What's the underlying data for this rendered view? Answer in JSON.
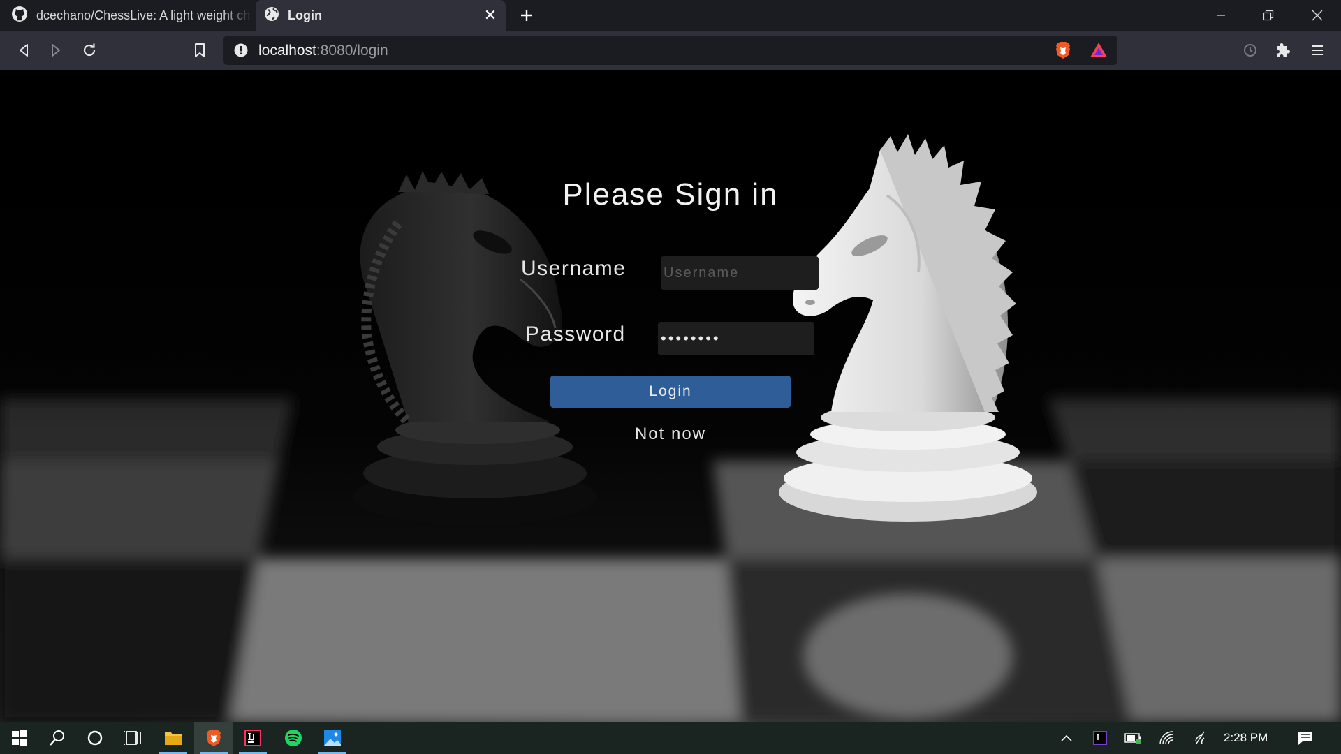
{
  "browser": {
    "tabs": [
      {
        "title": "dcechano/ChessLive: A light weight ch",
        "icon": "github-icon",
        "active": false
      },
      {
        "title": "Login",
        "icon": "globe-icon",
        "active": true
      }
    ],
    "address_bar": {
      "host": "localhost",
      "path": ":8080/login"
    }
  },
  "page": {
    "heading": "Please Sign in",
    "username": {
      "label": "Username",
      "placeholder": "Username",
      "value": ""
    },
    "password": {
      "label": "Password",
      "value": "••••••••"
    },
    "login_button": "Login",
    "not_now": "Not now"
  },
  "taskbar": {
    "apps": [
      "windows-start-icon",
      "search-icon",
      "cortana-icon",
      "task-view-icon",
      "file-explorer-icon",
      "brave-icon",
      "intellij-icon",
      "spotify-icon",
      "photos-icon"
    ],
    "clock": "2:28 PM"
  },
  "colors": {
    "accent_button": "#2f5d98",
    "browser_tabbar": "#1b1c22",
    "browser_toolbar": "#2f3039",
    "taskbar": "#1a2521"
  }
}
